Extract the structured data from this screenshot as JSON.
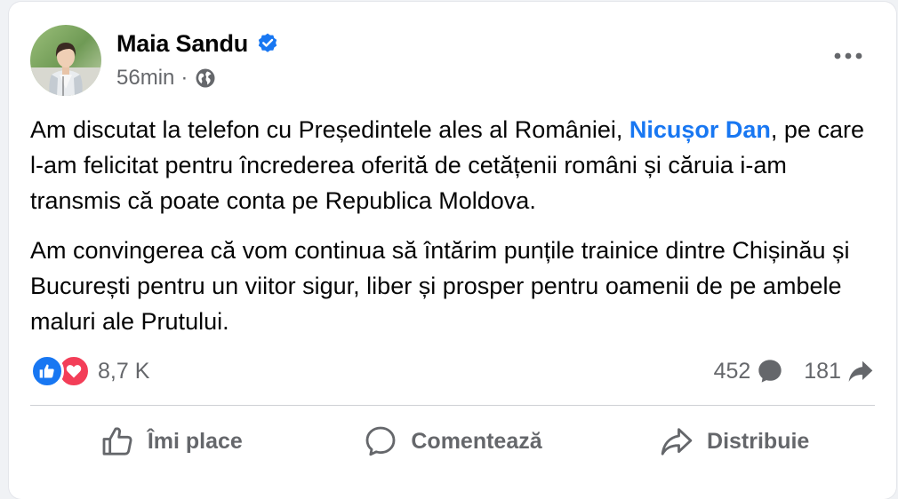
{
  "post": {
    "author": "Maia Sandu",
    "timestamp": "56min",
    "separator": "·",
    "audience_icon": "globe-icon",
    "verified_icon": "verified-badge-icon",
    "more_icon": "more-horizontal-icon",
    "paragraph1_before": "Am discutat la telefon cu Președintele ales al României, ",
    "mention": "Nicușor Dan",
    "paragraph1_after": ", pe care l-am felicitat pentru încrederea oferită de cetățenii români și căruia i-am transmis că poate conta pe Republica Moldova.",
    "paragraph2": "Am convingerea că vom continua să întărim punțile trainice dintre Chișinău și București pentru un viitor sigur, liber și prosper pentru oamenii de pe ambele maluri ale Prutului."
  },
  "stats": {
    "reactions_count": "8,7 K",
    "reaction_types": [
      "like",
      "love"
    ],
    "comments_count": "452",
    "shares_count": "181"
  },
  "actions": {
    "like": "Îmi place",
    "comment": "Comentează",
    "share": "Distribuie"
  },
  "colors": {
    "accent": "#1877f2",
    "love": "#f33e58",
    "secondary_text": "#65676b",
    "text": "#050505",
    "divider": "#ced0d4"
  }
}
